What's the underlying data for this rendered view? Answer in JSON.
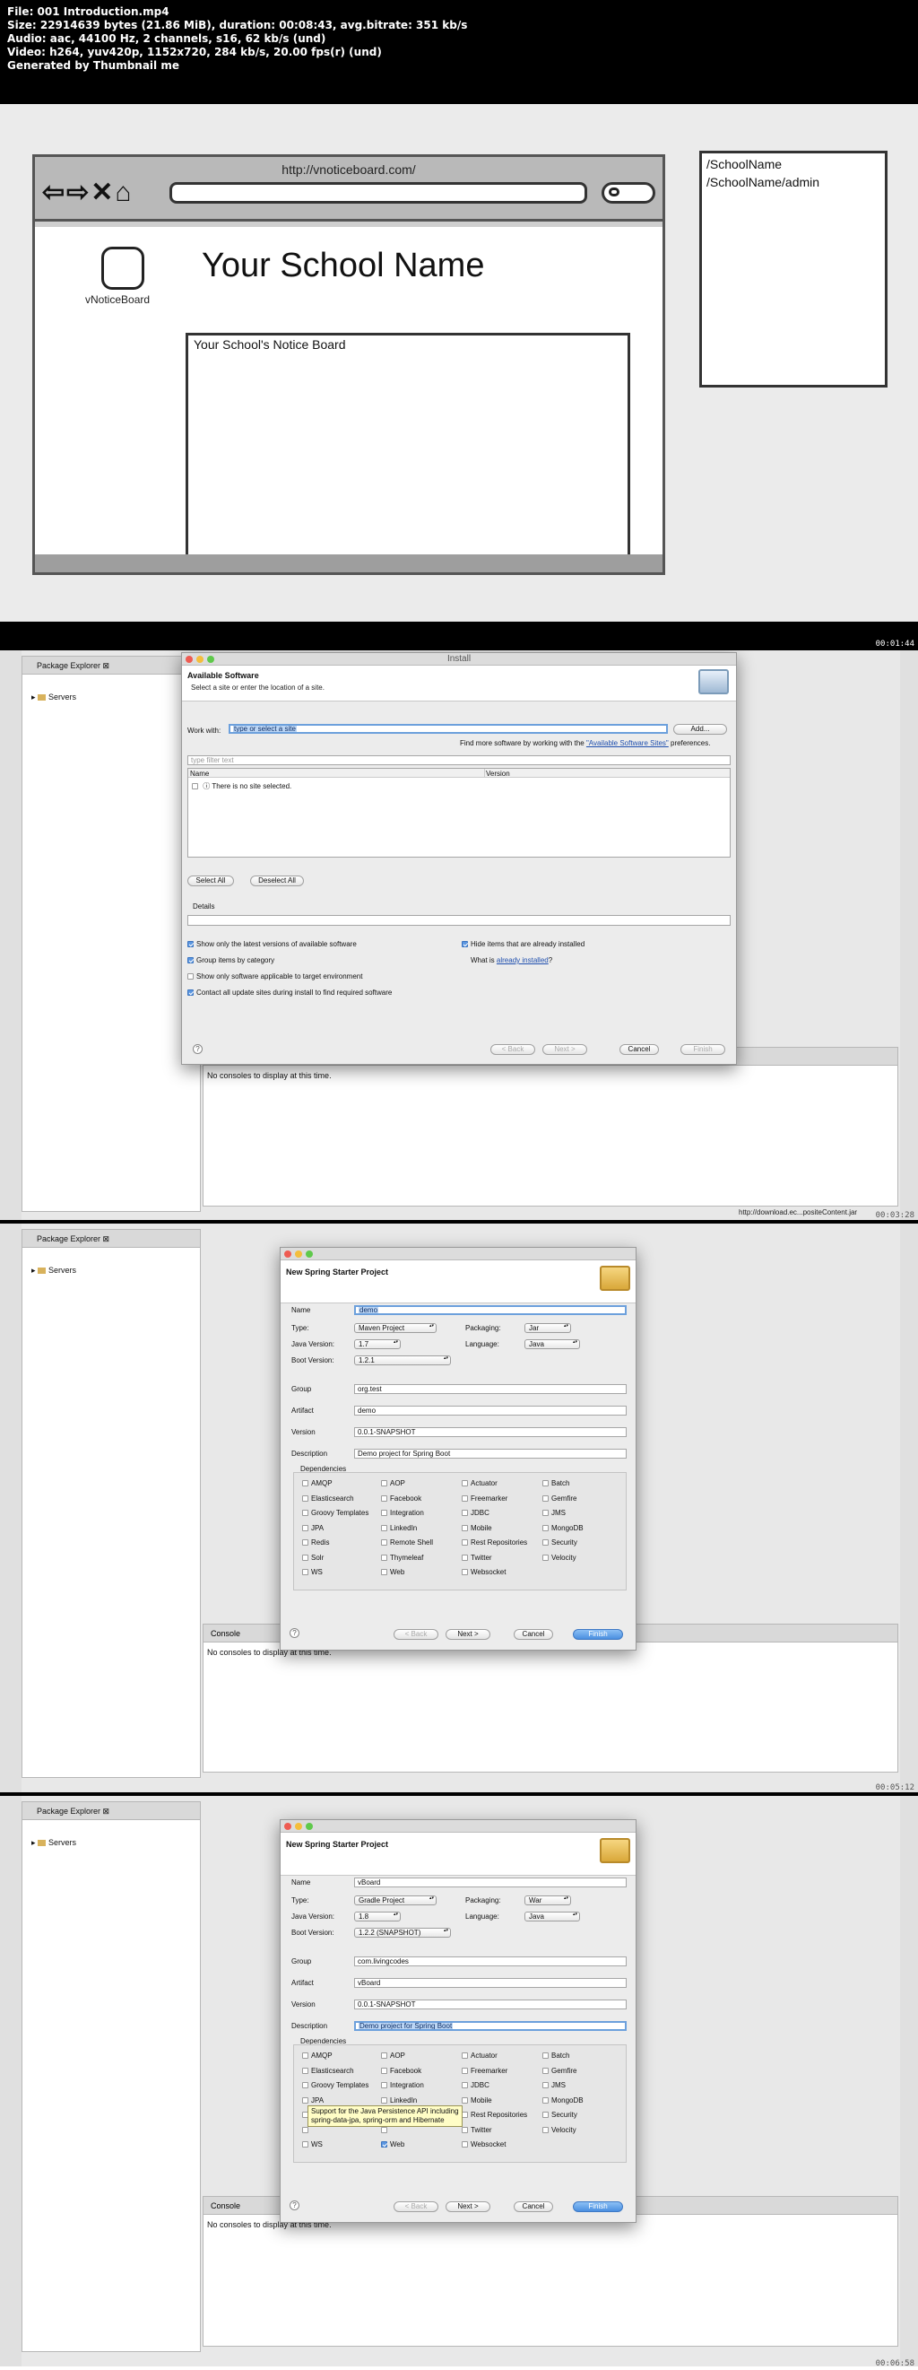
{
  "header": {
    "lines": [
      "File: 001 Introduction.mp4",
      "Size: 22914639 bytes (21.86 MiB), duration: 00:08:43, avg.bitrate: 351 kb/s",
      "Audio: aac, 44100 Hz, 2 channels, s16, 62 kb/s (und)",
      "Video: h264, yuv420p, 1152x720, 284 kb/s, 20.00 fps(r) (und)",
      "Generated by Thumbnail me"
    ]
  },
  "frame1": {
    "timestamp": "00:01:44",
    "mockup": {
      "url": "http://vnoticeboard.com/",
      "logo_text": "vNoticeBoard",
      "site_title": "Your School Name",
      "board_label": "Your School's Notice Board",
      "side_links": [
        "/SchoolName",
        "/SchoolName/admin"
      ]
    }
  },
  "frame2": {
    "timestamp": "00:03:28",
    "package_explorer": {
      "tab": "Package Explorer",
      "tree_item": "Servers"
    },
    "console": {
      "message": "No consoles to display at this time."
    },
    "status_url": "http://download.ec...positeContent.jar",
    "dialog": {
      "window_title": "Install",
      "heading": "Available Software",
      "subheading": "Select a site or enter the location of a site.",
      "work_with_label": "Work with:",
      "work_with_value": "type or select a site",
      "add_button": "Add...",
      "find_more_prefix": "Find more software by working with the ",
      "find_more_link": "\"Available Software Sites\"",
      "find_more_suffix": " preferences.",
      "filter_placeholder": "type filter text",
      "col_name": "Name",
      "col_version": "Version",
      "no_site": "There is no site selected.",
      "select_all": "Select All",
      "deselect_all": "Deselect All",
      "details_label": "Details",
      "options": [
        {
          "label": "Show only the latest versions of available software",
          "checked": true
        },
        {
          "label": "Group items by category",
          "checked": true
        },
        {
          "label": "Show only software applicable to target environment",
          "checked": false
        },
        {
          "label": "Contact all update sites during install to find required software",
          "checked": true
        }
      ],
      "hide_installed": "Hide items that are already installed",
      "what_is_prefix": "What is ",
      "what_is_link": "already installed",
      "what_is_suffix": "?",
      "back": "< Back",
      "next": "Next >",
      "cancel": "Cancel",
      "finish": "Finish"
    }
  },
  "frame3": {
    "timestamp": "00:05:12",
    "package_explorer": {
      "tab": "Package Explorer",
      "tree_item": "Servers"
    },
    "console": {
      "tab": "Console",
      "message": "No consoles to display at this time."
    },
    "dialog": {
      "heading": "New Spring Starter Project",
      "name_label": "Name",
      "name": "demo",
      "type_label": "Type:",
      "type": "Maven Project",
      "packaging_label": "Packaging:",
      "packaging": "Jar",
      "java_label": "Java Version:",
      "java": "1.7",
      "language_label": "Language:",
      "language": "Java",
      "boot_label": "Boot Version:",
      "boot": "1.2.1",
      "group_label": "Group",
      "group": "org.test",
      "artifact_label": "Artifact",
      "artifact": "demo",
      "version_label": "Version",
      "version": "0.0.1-SNAPSHOT",
      "description_label": "Description",
      "description": "Demo project for Spring Boot",
      "dependencies_label": "Dependencies",
      "deps": [
        [
          "AMQP",
          "AOP",
          "Actuator",
          "Batch"
        ],
        [
          "Elasticsearch",
          "Facebook",
          "Freemarker",
          "Gemfire"
        ],
        [
          "Groovy Templates",
          "Integration",
          "JDBC",
          "JMS"
        ],
        [
          "JPA",
          "LinkedIn",
          "Mobile",
          "MongoDB"
        ],
        [
          "Redis",
          "Remote Shell",
          "Rest Repositories",
          "Security"
        ],
        [
          "Solr",
          "Thymeleaf",
          "Twitter",
          "Velocity"
        ],
        [
          "WS",
          "Web",
          "Websocket",
          ""
        ]
      ],
      "checked": [],
      "back": "< Back",
      "next": "Next >",
      "cancel": "Cancel",
      "finish": "Finish"
    }
  },
  "frame4": {
    "timestamp": "00:06:58",
    "package_explorer": {
      "tab": "Package Explorer",
      "tree_item": "Servers"
    },
    "console": {
      "tab": "Console",
      "message": "No consoles to display at this time."
    },
    "dialog": {
      "heading": "New Spring Starter Project",
      "name_label": "Name",
      "name": "vBoard",
      "type_label": "Type:",
      "type": "Gradle Project",
      "packaging_label": "Packaging:",
      "packaging": "War",
      "java_label": "Java Version:",
      "java": "1.8",
      "language_label": "Language:",
      "language": "Java",
      "boot_label": "Boot Version:",
      "boot": "1.2.2 (SNAPSHOT)",
      "group_label": "Group",
      "group": "com.livingcodes",
      "artifact_label": "Artifact",
      "artifact": "vBoard",
      "version_label": "Version",
      "version": "0.0.1-SNAPSHOT",
      "description_label": "Description",
      "description": "Demo project for Spring Boot",
      "dependencies_label": "Dependencies",
      "deps": [
        [
          "AMQP",
          "AOP",
          "Actuator",
          "Batch"
        ],
        [
          "Elasticsearch",
          "Facebook",
          "Freemarker",
          "Gemfire"
        ],
        [
          "Groovy Templates",
          "Integration",
          "JDBC",
          "JMS"
        ],
        [
          "JPA",
          "LinkedIn",
          "Mobile",
          "MongoDB"
        ],
        [
          "",
          "",
          "Rest Repositories",
          "Security"
        ],
        [
          "",
          "",
          "Twitter",
          "Velocity"
        ],
        [
          "WS",
          "Web",
          "Websocket",
          ""
        ]
      ],
      "checked": [
        "Web"
      ],
      "tooltip_lines": [
        "Support for the Java Persistence API including",
        "spring-data-jpa, spring-orm and Hibernate"
      ],
      "back": "< Back",
      "next": "Next >",
      "cancel": "Cancel",
      "finish": "Finish"
    }
  }
}
